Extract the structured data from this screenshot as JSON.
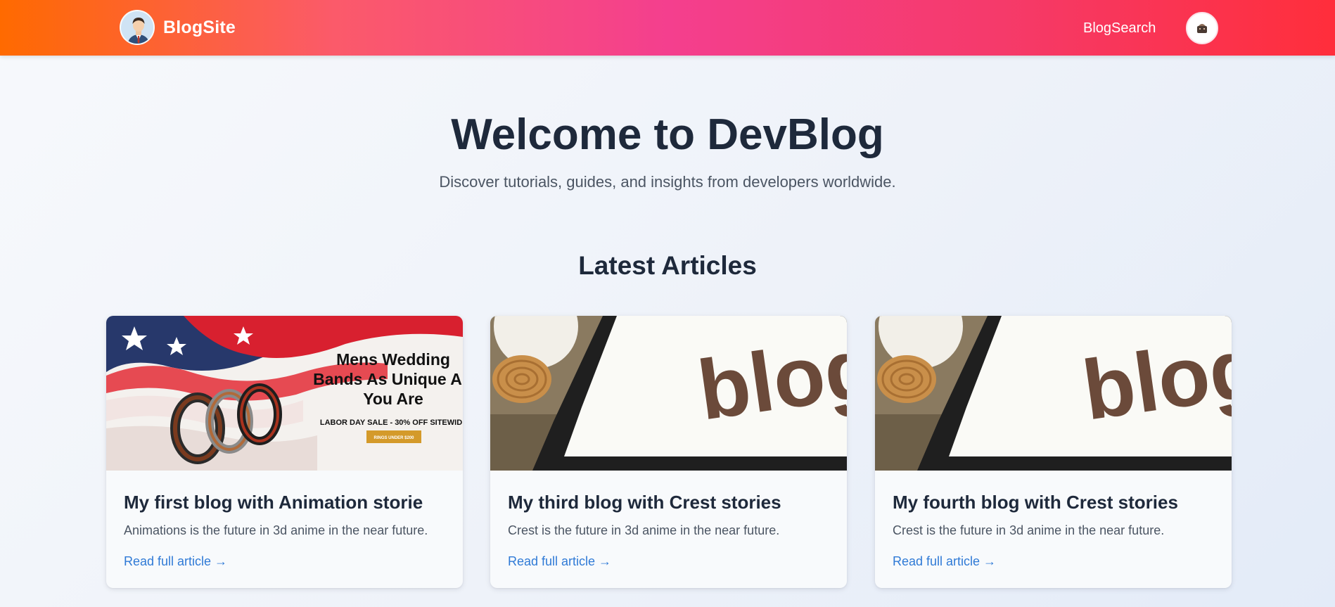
{
  "nav": {
    "brand": "BlogSite",
    "search_link": "BlogSearch"
  },
  "hero": {
    "title": "Welcome to DevBlog",
    "subtitle": "Discover tutorials, guides, and insights from developers worldwide."
  },
  "latest": {
    "title": "Latest Articles",
    "cards": [
      {
        "title": "My first blog with Animation storie",
        "description": "Animations is the future in 3d anime in the near future.",
        "link": "Read full article →",
        "image": {
          "headline_1": "Mens Wedding",
          "headline_2": "Bands As Unique A",
          "headline_3": "You Are",
          "sale": "LABOR DAY SALE - 30% OFF SITEWID",
          "button": "RINGS UNDER $200"
        }
      },
      {
        "title": "My third blog with Crest stories",
        "description": "Crest is the future in 3d anime in the near future.",
        "link": "Read full article →",
        "image": {
          "word": "blog"
        }
      },
      {
        "title": "My fourth blog with Crest stories",
        "description": "Crest is the future in 3d anime in the near future.",
        "link": "Read full article →",
        "image": {
          "word": "blog"
        }
      }
    ]
  },
  "colors": {
    "link": "#2f7ad6",
    "heading": "#1e293b",
    "nav_gradient": [
      "#ff6a00",
      "#f43f8e",
      "#ff2e3b"
    ]
  }
}
